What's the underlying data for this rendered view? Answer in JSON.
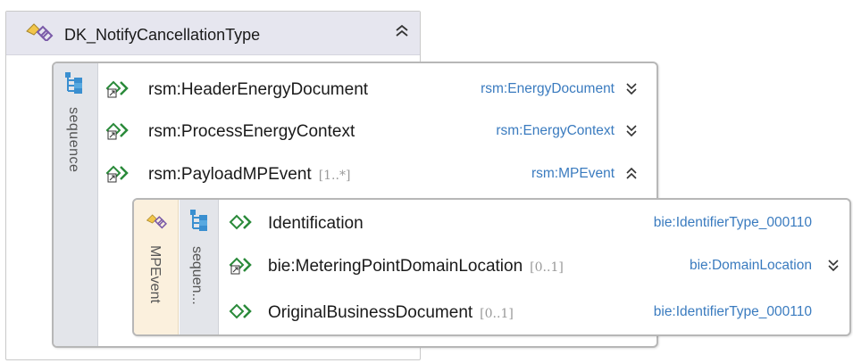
{
  "outer": {
    "title": "DK_NotifyCancellationType",
    "type_icon": "complex-type-icon",
    "collapse_icon": "double-chevron-up-icon"
  },
  "sequence": {
    "label": "sequence",
    "icon": "sequence-icon",
    "rows": [
      {
        "name": "rsm:HeaderEnergyDocument",
        "occurrence": "",
        "type": "rsm:EnergyDocument",
        "toggle_icon": "double-chevron-down-icon",
        "element_icon": "element-reference-icon"
      },
      {
        "name": "rsm:ProcessEnergyContext",
        "occurrence": "",
        "type": "rsm:EnergyContext",
        "toggle_icon": "double-chevron-down-icon",
        "element_icon": "element-reference-icon"
      },
      {
        "name": "rsm:PayloadMPEvent",
        "occurrence": "[1..*]",
        "type": "rsm:MPEvent",
        "toggle_icon": "double-chevron-up-icon",
        "element_icon": "element-reference-icon"
      }
    ]
  },
  "mpevent": {
    "label": "MPEvent",
    "icon": "complex-type-icon",
    "sequence_label": "sequen...",
    "rows": [
      {
        "name": "Identification",
        "occurrence": "",
        "type": "bie:IdentifierType_000110",
        "element_icon": "element-icon"
      },
      {
        "name": "bie:MeteringPointDomainLocation",
        "occurrence": "[0..1]",
        "type": "bie:DomainLocation",
        "toggle_icon": "double-chevron-down-icon",
        "element_icon": "element-reference-icon"
      },
      {
        "name": "OriginalBusinessDocument",
        "occurrence": "[0..1]",
        "type": "bie:IdentifierType_000110",
        "element_icon": "element-icon"
      }
    ]
  },
  "colors": {
    "type_link": "#3a7bbf",
    "element_icon": "#2a8a3a",
    "header_band": "#e6e6ef",
    "mpevent_band": "#fbf0dd",
    "sequence_band": "#e3e5ea"
  }
}
